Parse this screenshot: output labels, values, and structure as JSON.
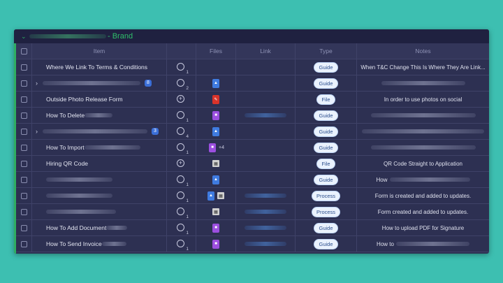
{
  "group": {
    "title": "- Brand"
  },
  "columns": {
    "item": "Item",
    "files": "Files",
    "link": "Link",
    "type": "Type",
    "notes": "Notes"
  },
  "rows": [
    {
      "item": "Where We Link To Terms & Conditions",
      "updates": "1",
      "files": [],
      "type": "Guide",
      "notes": "When T&C Change This Is Where They Are Link..."
    },
    {
      "item": "",
      "count": "8",
      "updates": "2",
      "files": [
        "drive"
      ],
      "type": "Guide",
      "notes": ""
    },
    {
      "item": "Outside Photo Release Form",
      "updates": "+",
      "files": [
        "pdf"
      ],
      "type": "File",
      "notes": "In order to use photos on social"
    },
    {
      "item": "How To Delete",
      "updates": "1",
      "files": [
        "video"
      ],
      "type": "Guide",
      "notes": ""
    },
    {
      "item": "",
      "count": "3",
      "updates": "4",
      "files": [
        "drive"
      ],
      "type": "Guide",
      "notes": ""
    },
    {
      "item": "How To Import",
      "updates": "1",
      "files": [
        "video"
      ],
      "extra": "+4",
      "type": "Guide",
      "notes": ""
    },
    {
      "item": "Hiring QR Code",
      "updates": "+",
      "files": [
        "qr"
      ],
      "type": "File",
      "notes": "QR Code Straight to Application"
    },
    {
      "item": "",
      "updates": "1",
      "files": [
        "drive"
      ],
      "type": "Guide",
      "notes": "How"
    },
    {
      "item": "",
      "updates": "1",
      "files": [
        "drive",
        "qr"
      ],
      "type": "Process",
      "notes": "Form is created and added to updates."
    },
    {
      "item": "",
      "updates": "1",
      "files": [
        "qr"
      ],
      "type": "Process",
      "notes": "Form created and added to updates."
    },
    {
      "item": "How To Add Document",
      "updates": "1",
      "files": [
        "video"
      ],
      "type": "Guide",
      "notes": "How to upload PDF for Signature"
    },
    {
      "item": "How To Send Invoice",
      "updates": "1",
      "files": [
        "video"
      ],
      "type": "Guide",
      "notes": "How to"
    }
  ]
}
